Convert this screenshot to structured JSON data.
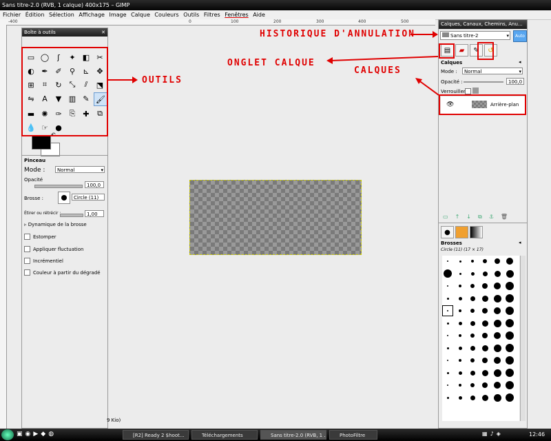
{
  "window": {
    "title": "Sans titre-2.0 (RVB, 1 calque) 400x175 – GIMP"
  },
  "menu": [
    "Fichier",
    "Édition",
    "Sélection",
    "Affichage",
    "Image",
    "Calque",
    "Couleurs",
    "Outils",
    "Filtres",
    "Fenêtres",
    "Aide"
  ],
  "ruler": {
    "top_ticks": [
      "-400",
      "0",
      "100",
      "200",
      "300",
      "400",
      "500",
      "600"
    ]
  },
  "toolbox": {
    "title": "Boîte à outils",
    "tool_icons": [
      "rect-select-icon",
      "ellipse-select-icon",
      "free-select-icon",
      "fuzzy-select-icon",
      "color-select-icon",
      "scissors-icon",
      "foreground-select-icon",
      "paths-icon",
      "color-picker-icon",
      "zoom-icon",
      "measure-icon",
      "move-icon",
      "align-icon",
      "crop-icon",
      "rotate-icon",
      "scale-icon",
      "shear-icon",
      "perspective-icon",
      "flip-icon",
      "text-icon",
      "bucket-fill-icon",
      "blend-icon",
      "pencil-icon",
      "paintbrush-icon",
      "eraser-icon",
      "airbrush-icon",
      "ink-icon",
      "clone-icon",
      "heal-icon",
      "perspective-clone-icon",
      "blur-icon",
      "smudge-icon",
      "dodge-burn-icon"
    ],
    "fg_color": "#000000",
    "bg_color": "#ffffff"
  },
  "tool_options": {
    "title": "Pinceau",
    "mode_label": "Mode :",
    "mode_value": "Normal",
    "opacity_label": "Opacité",
    "opacity_value": "100,0",
    "brush_label": "Brosse :",
    "brush_value": "Circle (11)",
    "scale_label": "Étirer ou rétrécir :",
    "scale_value": "1,00",
    "dynamics_label": "Dynamique de la brosse",
    "checkboxes": [
      "Estomper",
      "Appliquer fluctuation",
      "Incrémentiel",
      "Couleur à partir du dégradé"
    ]
  },
  "status_fragment": "9 Kio)",
  "dock": {
    "title": "Calques, Canaux, Chemins, Anu...",
    "image_select": "Sans titre-2",
    "auto_label": "Auto",
    "layers_header": "Calques",
    "mode_label": "Mode :",
    "mode_value": "Normal",
    "opacity_label": "Opacité :",
    "opacity_value": "100,0",
    "lock_label": "Verrouiller :",
    "layer_name": "Arrière-plan",
    "brushes_header": "Brosses",
    "brush_selected": "Circle (11) (17 × 17)"
  },
  "annotations": {
    "historique": "HISTORIQUE D'ANNULATION",
    "onglet": "ONGLET CALQUE",
    "calques": "CALQUES",
    "outils": "OUTILS",
    "color": "#e00000"
  },
  "taskbar": {
    "tasks": [
      "[R2] Ready 2 $hoot...",
      "Téléchargements",
      "Sans titre-2.0 (RVB, 1 ...",
      "PhotoFiltre"
    ],
    "clock": "12:46"
  }
}
